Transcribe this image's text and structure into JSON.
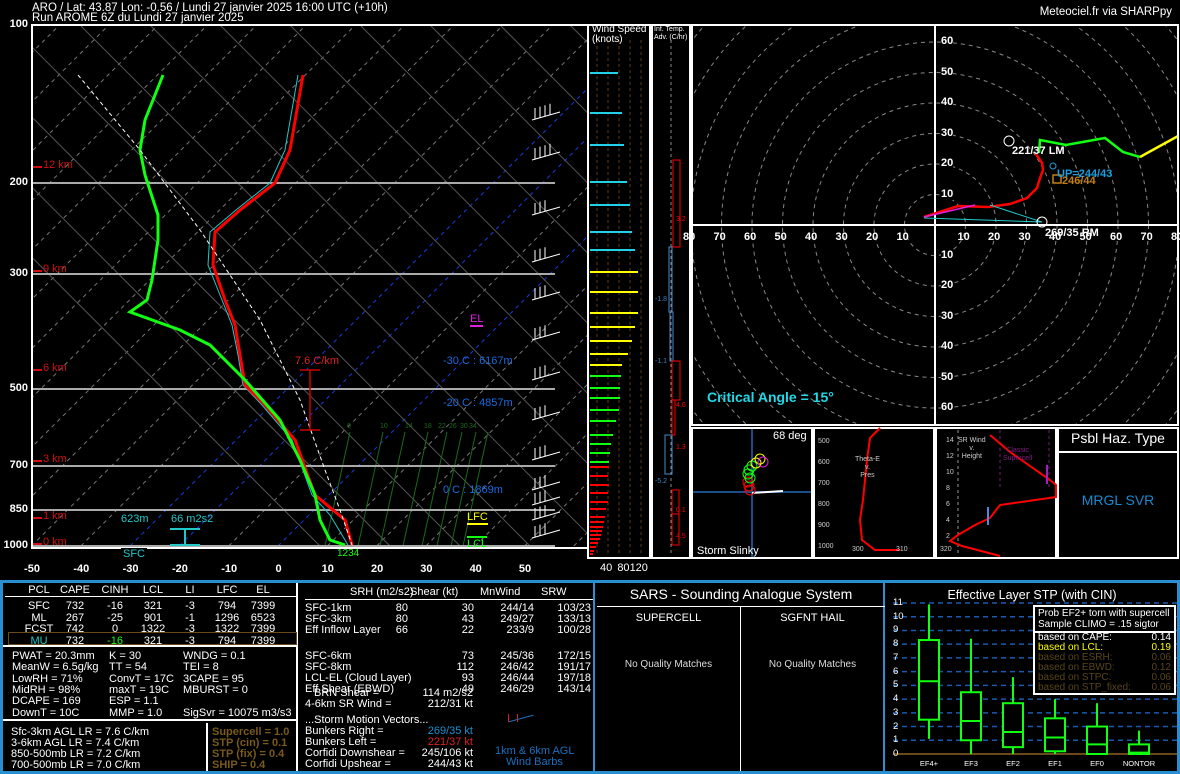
{
  "header": {
    "line1": "ARO / Lat: 43.87 Lon: -0.56 / Lundi 27 janvier 2025 16:00 UTC (+10h)",
    "line2": "Run AROME 6Z du Lundi 27 janvier 2025",
    "credit": "Meteociel.fr via SHARPpy"
  },
  "skewt": {
    "pressure_labels": [
      "100",
      "200",
      "300",
      "500",
      "700",
      "850",
      "1000"
    ],
    "temp_labels": [
      "-50",
      "-40",
      "-30",
      "-20",
      "-10",
      "0",
      "10",
      "20",
      "30",
      "40",
      "50"
    ],
    "height_labels": [
      "12 km",
      "9 km",
      "6 km",
      "3 km",
      "1 km",
      "0 km"
    ],
    "lapse_rate": "7.6 C/km",
    "el": "EL",
    "lfc": "LFC",
    "lcl": "LCL",
    "levels": [
      "-30 C : 6167m",
      "-20 C : 4857m",
      "0 C : 1869m"
    ],
    "eff_inflow_depth": "623m",
    "eff_inflow_srh": "66 m2s2",
    "sfc": "SFC",
    "parcel_nums": "1234",
    "mixing_ratios": [
      "6",
      "10",
      "14",
      "18",
      "22",
      "26",
      "30",
      "34"
    ]
  },
  "windspeed": {
    "title1": "Wind Speed",
    "title2": "(knots)",
    "axis": [
      "40",
      "80",
      "120"
    ]
  },
  "tempadv": {
    "title1": "Inf. Temp.",
    "title2": "Adv. (C/hr)",
    "values": [
      "3.2",
      "-1.8",
      "-1.1",
      "4.6",
      "1.3",
      "-5.2",
      "0.1",
      "4.5"
    ]
  },
  "hodo": {
    "rings": [
      "10",
      "20",
      "30",
      "40",
      "50",
      "60",
      "70",
      "80"
    ],
    "lm": "221/37 LM",
    "rm": "269/35 RM",
    "up": "UP=244/43",
    "dn": "246/44",
    "critical_angle": "Critical Angle = 15°"
  },
  "slinky": {
    "deg": "68 deg",
    "label": "Storm Slinky"
  },
  "thetae": {
    "title": [
      "Theta-E",
      "v.",
      "Pres"
    ],
    "y": [
      "500",
      "600",
      "700",
      "800",
      "900",
      "1000"
    ],
    "x": [
      "300",
      "310",
      "320"
    ]
  },
  "srwind": {
    "title": [
      "SR Wind",
      "v.",
      "Height"
    ],
    "y": [
      "14",
      "12",
      "10",
      "8",
      "6",
      "4",
      "2"
    ],
    "classic": [
      "Classic",
      "Supercell"
    ]
  },
  "haz": {
    "title": "Psbl Haz. Type",
    "value": "MRGL SVR"
  },
  "parcels": {
    "headers": [
      "PCL",
      "CAPE",
      "CINH",
      "LCL",
      "LI",
      "LFC",
      "EL"
    ],
    "rows": [
      [
        "SFC",
        "732",
        "-16",
        "321",
        "-3",
        "794",
        "7399"
      ],
      [
        "ML",
        "267",
        "-25",
        "901",
        "-1",
        "1296",
        "6523"
      ],
      [
        "FCST",
        "742",
        "0",
        "1322",
        "-3",
        "1322",
        "7399"
      ],
      [
        "MU",
        "732",
        "-16",
        "321",
        "-3",
        "794",
        "7399"
      ]
    ]
  },
  "indices": [
    [
      "PWAT = 20.3mm",
      "K = 30",
      "WNDG = 0.1"
    ],
    [
      "MeanW = 6.5g/kg",
      "TT = 54",
      "TEI = 8"
    ],
    [
      "LowRH = 71%",
      "ConvT = 17C",
      "3CAPE = 95"
    ],
    [
      "MidRH = 98%",
      "maxT = 19C",
      "MBURST = 0"
    ],
    [
      "DCAPE = 169",
      "ESP = 1.1",
      ""
    ],
    [
      "DownT = 10C",
      "MMP = 1.0",
      "SigSvr = 10075 m3/s3"
    ]
  ],
  "lapse": [
    "Sfc-3km AGL LR = 7.6 C/km",
    "3-6km AGL LR = 7.4 C/km",
    "850-500mb LR = 7.2 C/km",
    "700-500mb LR = 7.0 C/km"
  ],
  "composites": [
    "Supercell = 1.0",
    "STP (cin) = 0.1",
    "STP (fix) = 0.4",
    "SHIP = 0.4"
  ],
  "kinematics": {
    "headers": [
      "SRH (m2/s2)",
      "Shear (kt)",
      "MnWind",
      "SRW"
    ],
    "rows": [
      [
        "SFC-1km",
        "80",
        "30",
        "244/14",
        "103/23"
      ],
      [
        "SFC-3km",
        "80",
        "43",
        "249/27",
        "133/13"
      ],
      [
        "Eff Inflow Layer",
        "66",
        "22",
        "233/9",
        "100/28"
      ],
      [
        "SFC-6km",
        "",
        "73",
        "245/36",
        "172/15"
      ],
      [
        "SFC-8km",
        "",
        "112",
        "246/42",
        "191/17"
      ],
      [
        "LCL-EL (Cloud Layer)",
        "",
        "93",
        "246/44",
        "197/18"
      ],
      [
        "Eff Shear (EBWD)",
        "",
        "49",
        "246/29",
        "143/14"
      ]
    ],
    "brn_label": "BRN Shear =",
    "brn": "114 m2/s2",
    "sr46_label": "4-6km SR Wind =",
    "sr46": "212/31 kt",
    "storm_title": "...Storm Motion Vectors...",
    "storm": [
      [
        "Bunkers Right =",
        "269/35 kt"
      ],
      [
        "Bunkers Left =",
        "221/37 kt"
      ],
      [
        "Corfidi Downshear =",
        "245/106 kt"
      ],
      [
        "Corfidi Upshear =",
        "244/43 kt"
      ]
    ],
    "barbs_label1": "1km & 6km AGL",
    "barbs_label2": "Wind Barbs"
  },
  "sars": {
    "title": "SARS - Sounding Analogue System",
    "supercell": "SUPERCELL",
    "hail": "SGFNT HAIL",
    "sc_result": "No Quality Matches",
    "hail_result": "No Quality Matches"
  },
  "stp": {
    "title": "Effective Layer STP (with CIN)",
    "yticks": [
      "0",
      "1",
      "2",
      "3",
      "4",
      "5",
      "6",
      "7",
      "8",
      "9",
      "10",
      "11"
    ],
    "categories": [
      "EF4+",
      "EF3",
      "EF2",
      "EF1",
      "EF0",
      "NONTOR"
    ],
    "prob1": "Prob EF2+ torn with supercell",
    "prob2": "Sample CLIMO = .15 sigtor",
    "based": [
      [
        "based on CAPE:",
        "0.14"
      ],
      [
        "based on LCL:",
        "0.19"
      ],
      [
        "based on ESRH:",
        "0.06"
      ],
      [
        "based on EBWD:",
        "0.12"
      ],
      [
        "based on STPC:",
        "0.06"
      ],
      [
        "based on STP_fixed:",
        "0.06"
      ]
    ],
    "boxes": [
      [
        1.1,
        2.5,
        5.3,
        8.3,
        10.9
      ],
      [
        0,
        1,
        2.4,
        4.5,
        8.4
      ],
      [
        0,
        0.5,
        1.6,
        3.7,
        5.6
      ],
      [
        0,
        0.2,
        1.2,
        2.6,
        4
      ],
      [
        0,
        0,
        0.7,
        2,
        3.7
      ],
      [
        0,
        0,
        0.1,
        0.7,
        1.7
      ]
    ]
  }
}
